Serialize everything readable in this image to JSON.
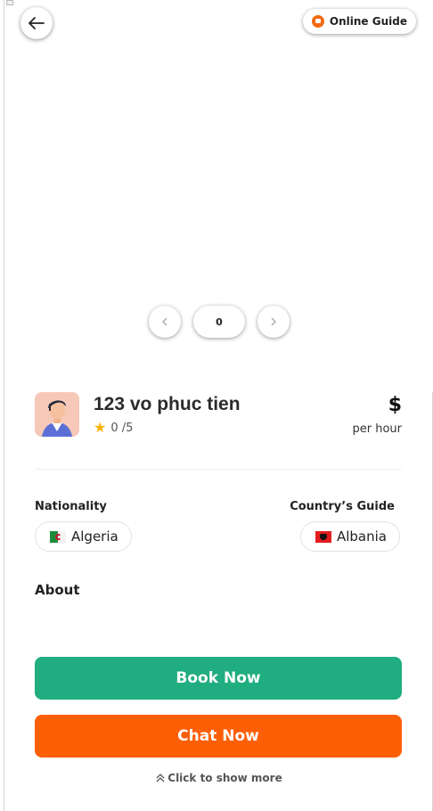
{
  "header": {
    "online_badge": "Online Guide"
  },
  "gallery": {
    "current_index": "0",
    "prev_icon": "chevron-left-icon",
    "next_icon": "chevron-right-icon"
  },
  "guide": {
    "name": "123 vo phuc tien",
    "rating": "0 /5",
    "price_symbol": "$",
    "price_unit": "per hour"
  },
  "details": {
    "nationality_label": "Nationality",
    "nationality_value": "Algeria",
    "country_label": "Country’s Guide",
    "country_value": "Albania",
    "about_label": "About"
  },
  "actions": {
    "book_label": "Book Now",
    "chat_label": "Chat Now",
    "show_more_label": "Click to show more"
  },
  "colors": {
    "book": "#20ad80",
    "chat": "#fd5f07",
    "online": "#f26a10",
    "star": "#f5b400"
  }
}
